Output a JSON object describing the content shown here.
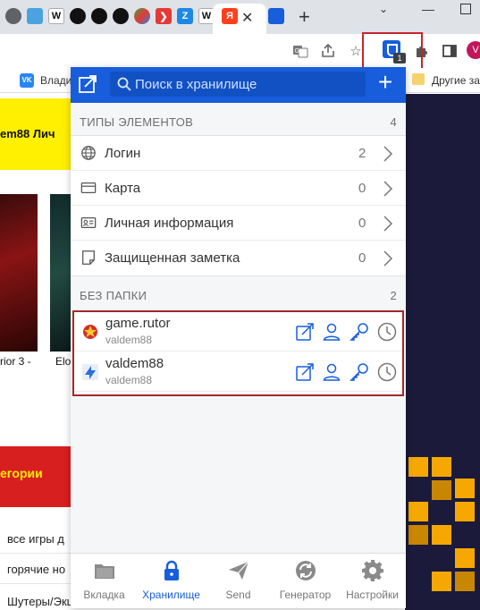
{
  "browser": {
    "tabs": [
      {
        "icon": "globe-icon",
        "color": "#5f6368",
        "glyph": "●"
      },
      {
        "icon": "gear-favicon-icon",
        "color": "#4aa3df",
        "glyph": "✺"
      },
      {
        "icon": "wikipedia-icon",
        "color": "#ffffff",
        "glyph": "W"
      },
      {
        "icon": "github-icon",
        "color": "#111111",
        "glyph": "●"
      },
      {
        "icon": "github-icon",
        "color": "#111111",
        "glyph": "●"
      },
      {
        "icon": "color-favicon-icon",
        "color": "#2e7d32",
        "glyph": "●"
      },
      {
        "icon": "arrow-favicon-icon",
        "color": "#e53935",
        "glyph": "❯"
      },
      {
        "icon": "zoho-icon",
        "color": "#1e88e5",
        "glyph": "Z"
      },
      {
        "icon": "wikipedia-icon",
        "color": "#ffffff",
        "glyph": "W"
      },
      {
        "icon": "yandex-icon",
        "color": "#fc3f1d",
        "glyph": "Я"
      }
    ],
    "bookmarks": {
      "vk_label": "Влади",
      "vk_glyph": "VK",
      "other_label": "Другие за"
    },
    "extension_badge": "1",
    "avatar_letter": "V"
  },
  "background": {
    "yellow_text": "em88   Лич",
    "poster1_caption": "rior 3 -",
    "poster2_caption": "Elo",
    "red_text": "егории",
    "categories": [
      "все игры д",
      "горячие но",
      "Шутеры/Экшены"
    ]
  },
  "popup": {
    "search_placeholder": "Поиск в хранилище",
    "types_section": {
      "title": "ТИПЫ ЭЛЕМЕНТОВ",
      "count": "4"
    },
    "types": [
      {
        "label": "Логин",
        "count": "2",
        "icon": "globe-icon"
      },
      {
        "label": "Карта",
        "count": "0",
        "icon": "card-icon"
      },
      {
        "label": "Личная информация",
        "count": "0",
        "icon": "id-card-icon"
      },
      {
        "label": "Защищенная заметка",
        "count": "0",
        "icon": "note-icon"
      }
    ],
    "folder_section": {
      "title": "БЕЗ ПАПКИ",
      "count": "2"
    },
    "items": [
      {
        "name": "game.rutor",
        "username": "valdem88",
        "icon": "rutor-favicon-icon"
      },
      {
        "name": "valdem88",
        "username": "valdem88",
        "icon": "site-favicon-icon"
      }
    ],
    "tabbar": [
      {
        "label": "Вкладка",
        "icon": "folder-icon"
      },
      {
        "label": "Хранилище",
        "icon": "lock-icon",
        "active": true
      },
      {
        "label": "Send",
        "icon": "send-icon"
      },
      {
        "label": "Генератор",
        "icon": "refresh-icon"
      },
      {
        "label": "Настройки",
        "icon": "gear-icon"
      }
    ],
    "accent_color": "#175ddc"
  }
}
